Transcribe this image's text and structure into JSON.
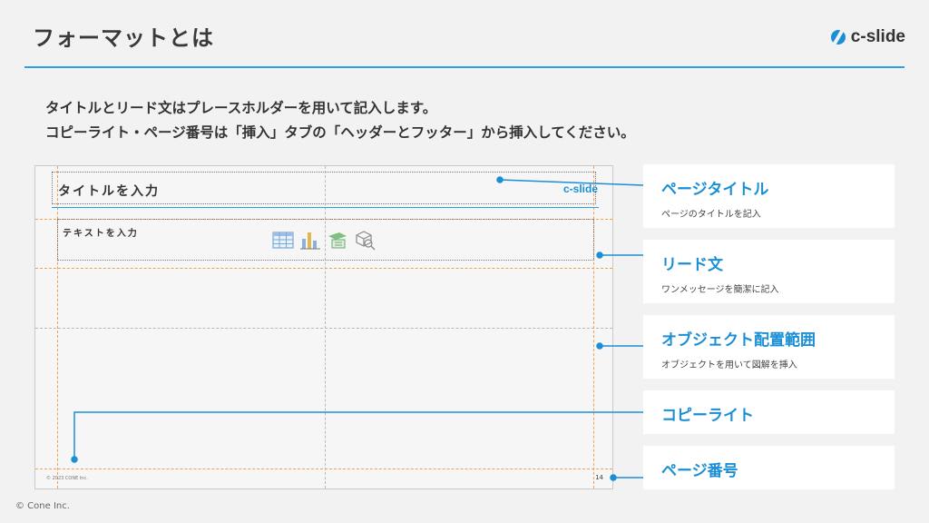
{
  "header": {
    "title": "フォーマットとは",
    "logo_text": "c-slide"
  },
  "intro": {
    "line1": "タイトルとリード文はプレースホルダーを用いて記入します。",
    "line2": "コピーライト・ページ番号は「挿入」タブの「ヘッダーとフッター」から挿入してください。"
  },
  "slide": {
    "title_placeholder": "タイトルを入力",
    "logo_text": "c-slide",
    "text_placeholder": "テキストを入力",
    "copyright": "© 2023 CONE Inc.",
    "page_number": "14",
    "icons": [
      "table-icon",
      "chart-icon",
      "smartart-icon",
      "3d-model-icon"
    ]
  },
  "cards": [
    {
      "title": "ページタイトル",
      "subtitle": "ページのタイトルを記入"
    },
    {
      "title": "リード文",
      "subtitle": "ワンメッセージを簡潔に記入"
    },
    {
      "title": "オブジェクト配置範囲",
      "subtitle": "オブジェクトを用いて図解を挿入"
    },
    {
      "title": "コピーライト",
      "subtitle": ""
    },
    {
      "title": "ページ番号",
      "subtitle": ""
    }
  ],
  "colors": {
    "accent": "#1a8fd6",
    "header_line": "#2aa0e0",
    "guide": "#f0a050"
  },
  "footer": {
    "copyright": "© Cone Inc."
  }
}
